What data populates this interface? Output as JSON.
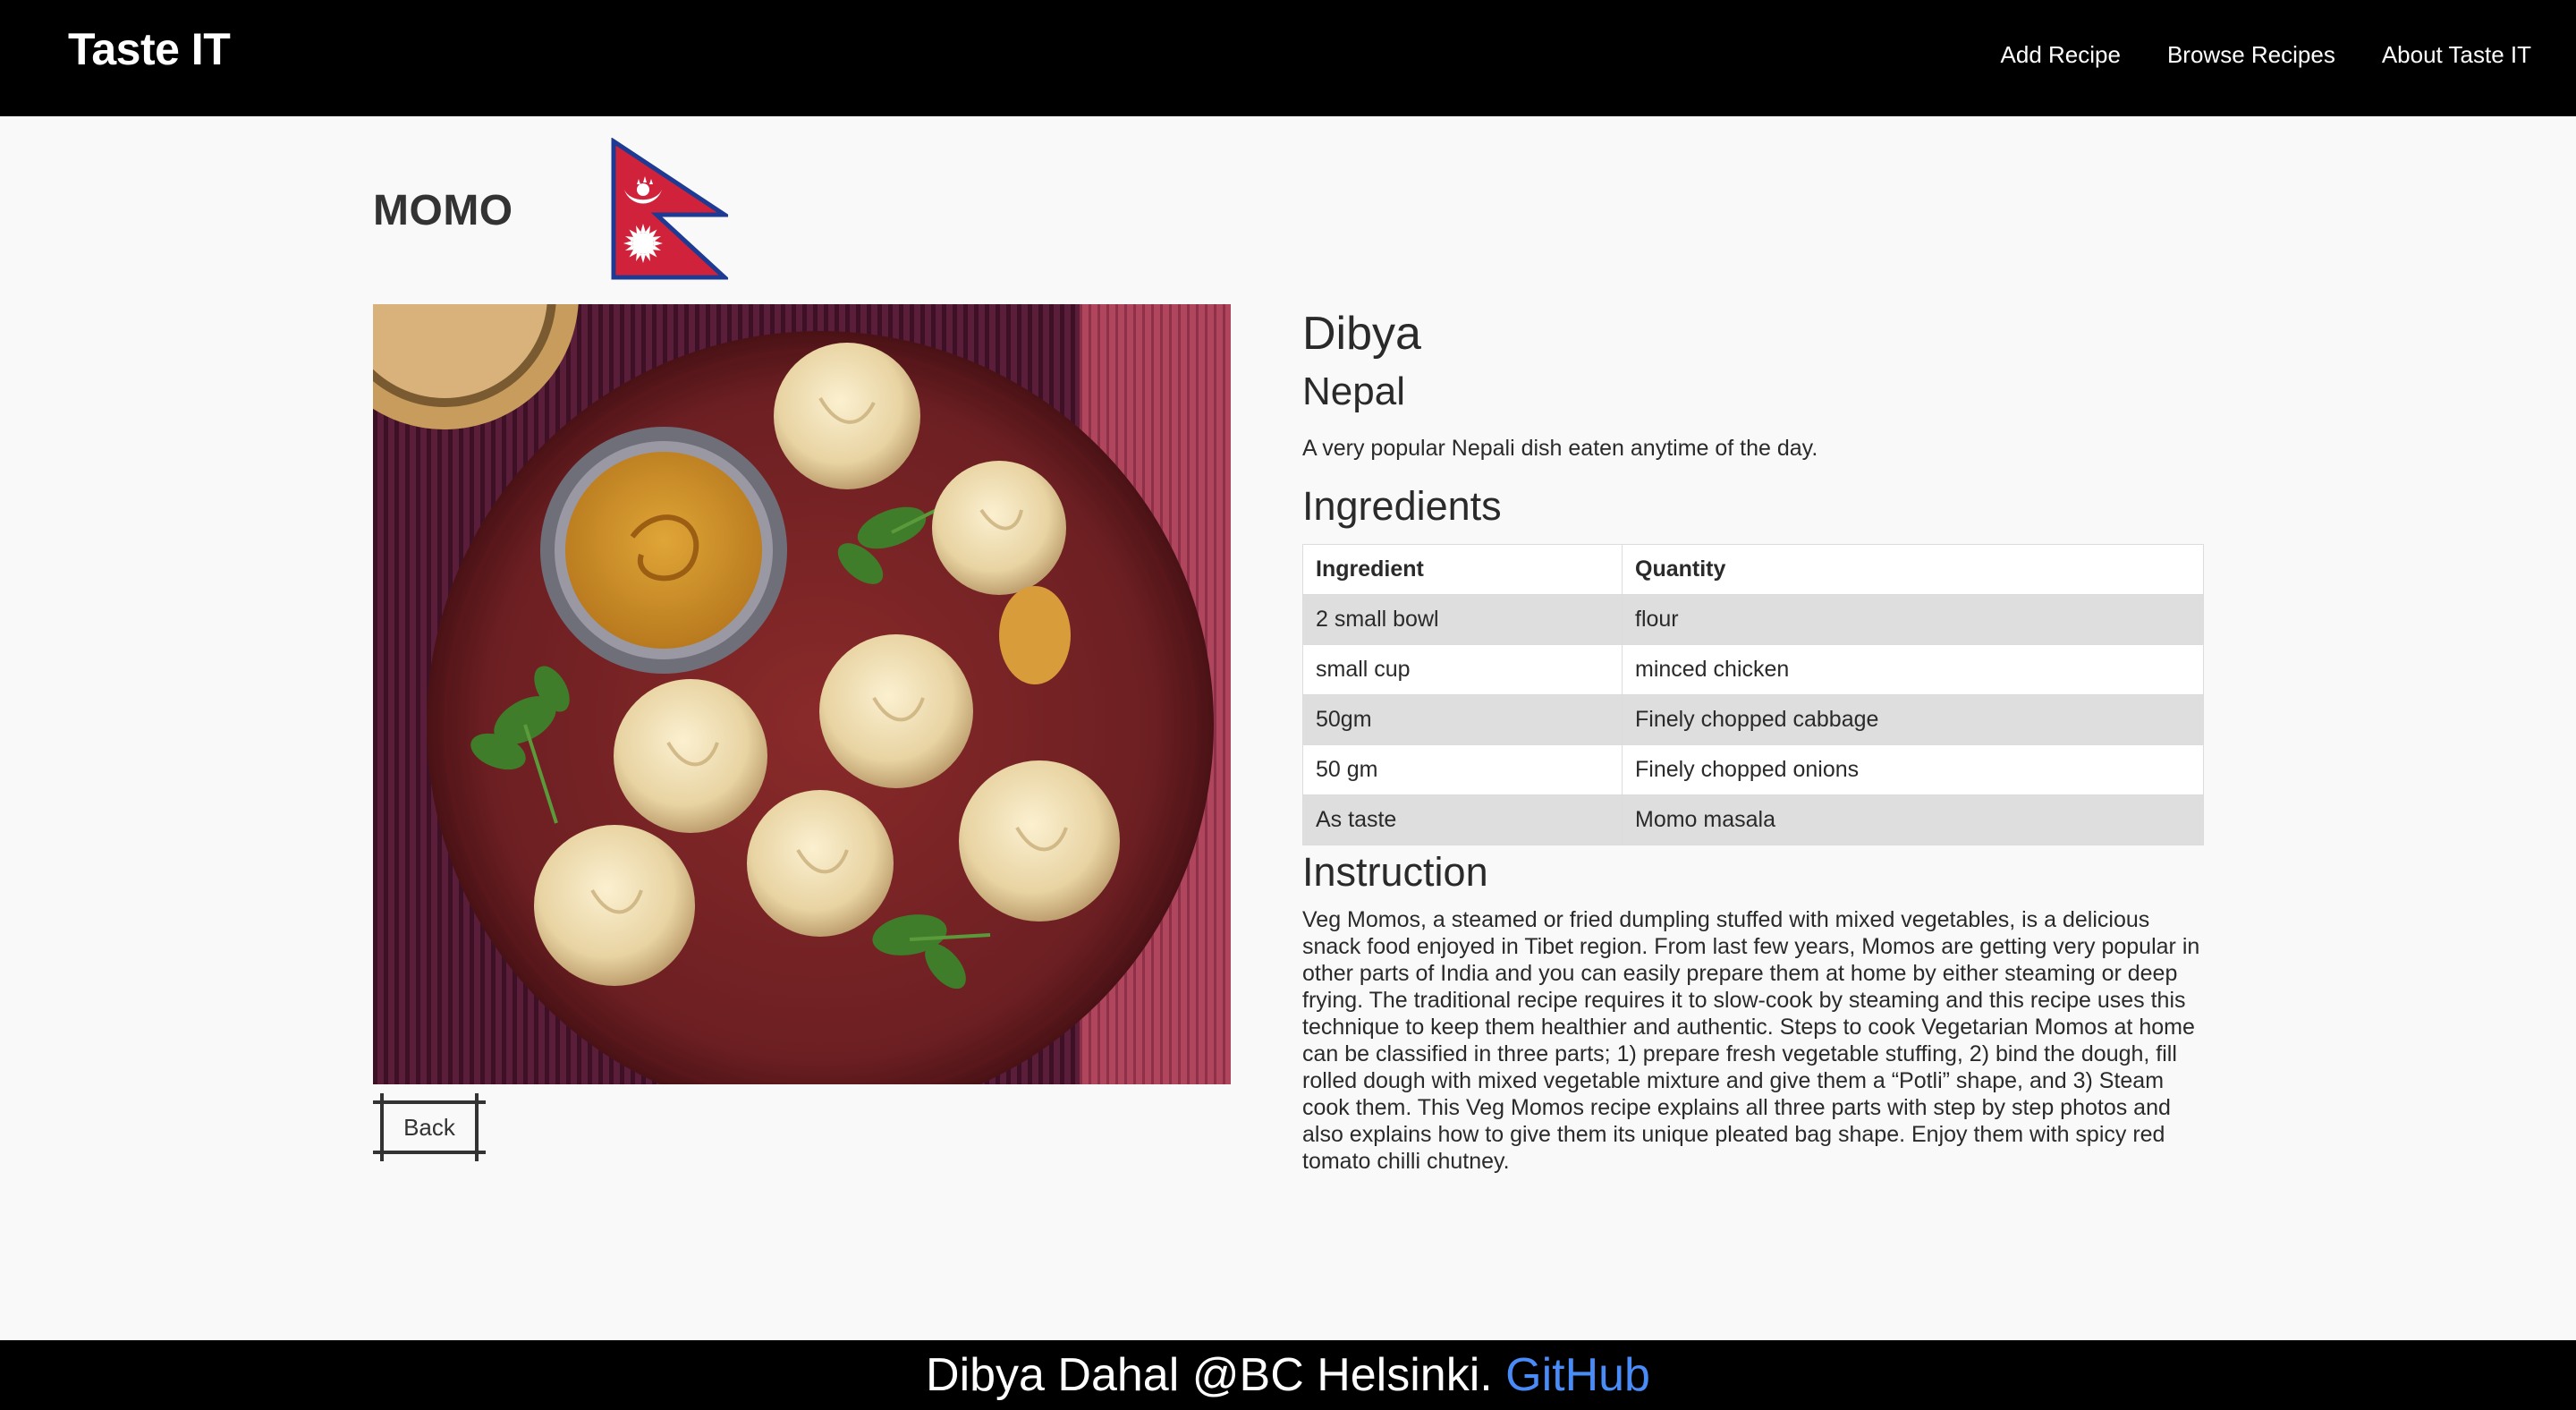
{
  "header": {
    "brand": "Taste IT",
    "nav": [
      "Add Recipe",
      "Browse Recipes",
      "About Taste IT"
    ]
  },
  "recipe": {
    "title": "MOMO",
    "author": "Dibya",
    "country": "Nepal",
    "description": "A very popular Nepali dish eaten anytime of the day.",
    "ingredients_heading": "Ingredients",
    "table_headers": [
      "Ingredient",
      "Quantity"
    ],
    "ingredients": [
      [
        "2 small bowl",
        "flour"
      ],
      [
        "small cup",
        "minced chicken"
      ],
      [
        "50gm",
        "Finely chopped cabbage"
      ],
      [
        "50 gm",
        "Finely chopped onions"
      ],
      [
        "As taste",
        "Momo masala"
      ]
    ],
    "instruction_heading": "Instruction",
    "instruction": "Veg Momos, a steamed or fried dumpling stuffed with mixed vegetables, is a delicious snack food enjoyed in Tibet region. From last few years, Momos are getting very popular in other parts of India and you can easily prepare them at home by either steaming or deep frying. The traditional recipe requires it to slow-cook by steaming and this recipe uses this technique to keep them healthier and authentic. Steps to cook Vegetarian Momos at home can be classified in three parts; 1) prepare fresh vegetable stuffing, 2) bind the dough, fill rolled dough with mixed vegetable mixture and give them a “Potli” shape, and 3) Steam cook them. This Veg Momos recipe explains all three parts with step by step photos and also explains how to give them its unique pleated bag shape. Enjoy them with spicy red tomato chilli chutney.",
    "back_label": "Back",
    "flag_icon": "nepal-flag-icon"
  },
  "footer": {
    "text": "Dibya Dahal @BC Helsinki. ",
    "link": "GitHub"
  },
  "colors": {
    "header_bg": "#000000",
    "page_bg": "#f9f9f9",
    "link_blue": "#4a8cf7",
    "row_alt": "#dedede"
  }
}
